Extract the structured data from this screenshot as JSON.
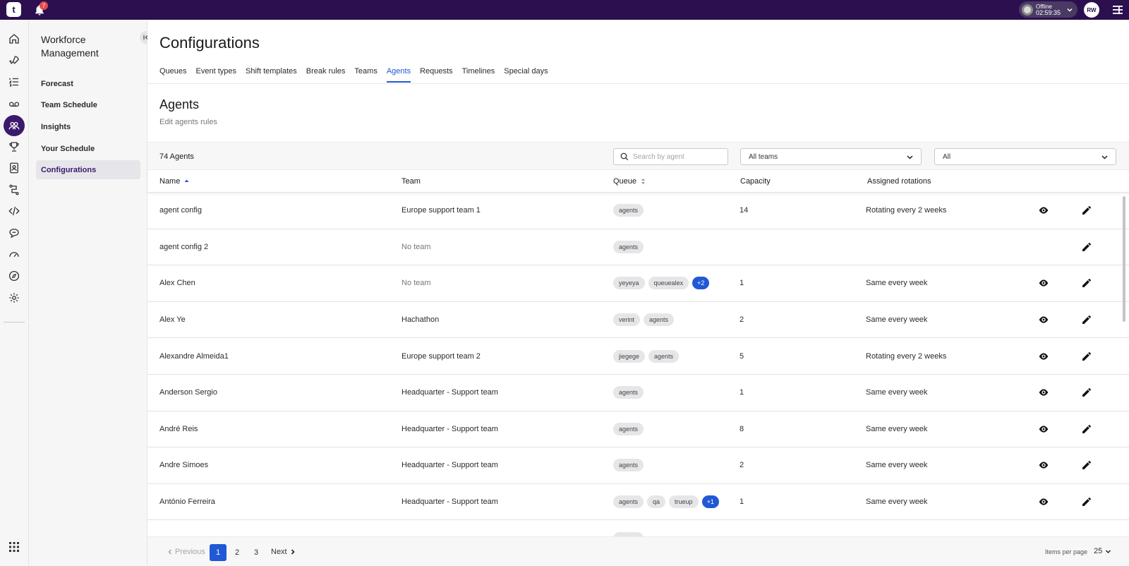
{
  "topbar": {
    "logo": "t",
    "notification_count": "7",
    "status_label": "Offline",
    "status_time": "02:59:35",
    "avatar_initials": "RW"
  },
  "rail": {
    "icons": [
      "home-icon",
      "rocket-icon",
      "list-icon",
      "voicemail-icon",
      "users-icon",
      "trophy-icon",
      "contacts-icon",
      "flow-icon",
      "code-icon",
      "chat-icon",
      "speedometer-icon",
      "compass-icon",
      "settings-icon",
      "apps-grid-icon"
    ]
  },
  "sidenav": {
    "title": "Workforce Management",
    "items": [
      {
        "label": "Forecast"
      },
      {
        "label": "Team Schedule"
      },
      {
        "label": "Insights"
      },
      {
        "label": "Your Schedule"
      },
      {
        "label": "Configurations"
      }
    ],
    "active_index": 4
  },
  "page": {
    "title": "Configurations",
    "tabs": [
      {
        "label": "Queues"
      },
      {
        "label": "Event types"
      },
      {
        "label": "Shift templates"
      },
      {
        "label": "Break rules"
      },
      {
        "label": "Teams"
      },
      {
        "label": "Agents"
      },
      {
        "label": "Requests"
      },
      {
        "label": "Timelines"
      },
      {
        "label": "Special days"
      }
    ],
    "active_tab": "Agents",
    "section_title": "Agents",
    "section_subtitle": "Edit agents rules"
  },
  "filters": {
    "count_label": "74 Agents",
    "search_placeholder": "Search by agent",
    "team_select": "All teams",
    "status_select": "All"
  },
  "table": {
    "columns": {
      "name": "Name",
      "team": "Team",
      "queue": "Queue",
      "capacity": "Capacity",
      "rotations": "Assigned rotations"
    },
    "rows": [
      {
        "name": "agent config",
        "team": "Europe support team 1",
        "team_muted": false,
        "queues": [
          "agents"
        ],
        "more": "",
        "capacity": "14",
        "rotation": "Rotating every 2 weeks",
        "has_view": true
      },
      {
        "name": "agent config 2",
        "team": "No team",
        "team_muted": true,
        "queues": [
          "agents"
        ],
        "more": "",
        "capacity": "",
        "rotation": "",
        "has_view": false
      },
      {
        "name": "Alex Chen",
        "team": "No team",
        "team_muted": true,
        "queues": [
          "yeyeya",
          "queuealex"
        ],
        "more": "+2",
        "capacity": "1",
        "rotation": "Same every week",
        "has_view": true
      },
      {
        "name": "Alex Ye",
        "team": "Hachathon",
        "team_muted": false,
        "queues": [
          "verint",
          "agents"
        ],
        "more": "",
        "capacity": "2",
        "rotation": "Same every week",
        "has_view": true
      },
      {
        "name": "Alexandre Almeida1",
        "team": "Europe support team 2",
        "team_muted": false,
        "queues": [
          "jiegege",
          "agents"
        ],
        "more": "",
        "capacity": "5",
        "rotation": "Rotating every 2 weeks",
        "has_view": true
      },
      {
        "name": "Anderson Sergio",
        "team": "Headquarter - Support team",
        "team_muted": false,
        "queues": [
          "agents"
        ],
        "more": "",
        "capacity": "1",
        "rotation": "Same every week",
        "has_view": true
      },
      {
        "name": "André Reis",
        "team": "Headquarter - Support team",
        "team_muted": false,
        "queues": [
          "agents"
        ],
        "more": "",
        "capacity": "8",
        "rotation": "Same every week",
        "has_view": true
      },
      {
        "name": "Andre Simoes",
        "team": "Headquarter - Support team",
        "team_muted": false,
        "queues": [
          "agents"
        ],
        "more": "",
        "capacity": "2",
        "rotation": "Same every week",
        "has_view": true
      },
      {
        "name": "António Ferreira",
        "team": "Headquarter - Support team",
        "team_muted": false,
        "queues": [
          "agents",
          "qa",
          "trueup"
        ],
        "more": "+1",
        "capacity": "1",
        "rotation": "Same every week",
        "has_view": true
      },
      {
        "name": "",
        "team": "",
        "team_muted": false,
        "queues": [
          "agents"
        ],
        "more": "",
        "capacity": "",
        "rotation": "",
        "has_view": false
      }
    ]
  },
  "pagination": {
    "previous": "Previous",
    "pages": [
      "1",
      "2",
      "3"
    ],
    "current": "1",
    "next": "Next",
    "items_per_page_label": "Items per page",
    "items_per_page": "25"
  },
  "colors": {
    "topbar": "#2b0f4f",
    "accent": "#2158d6",
    "active_nav": "#3b1a6b"
  }
}
